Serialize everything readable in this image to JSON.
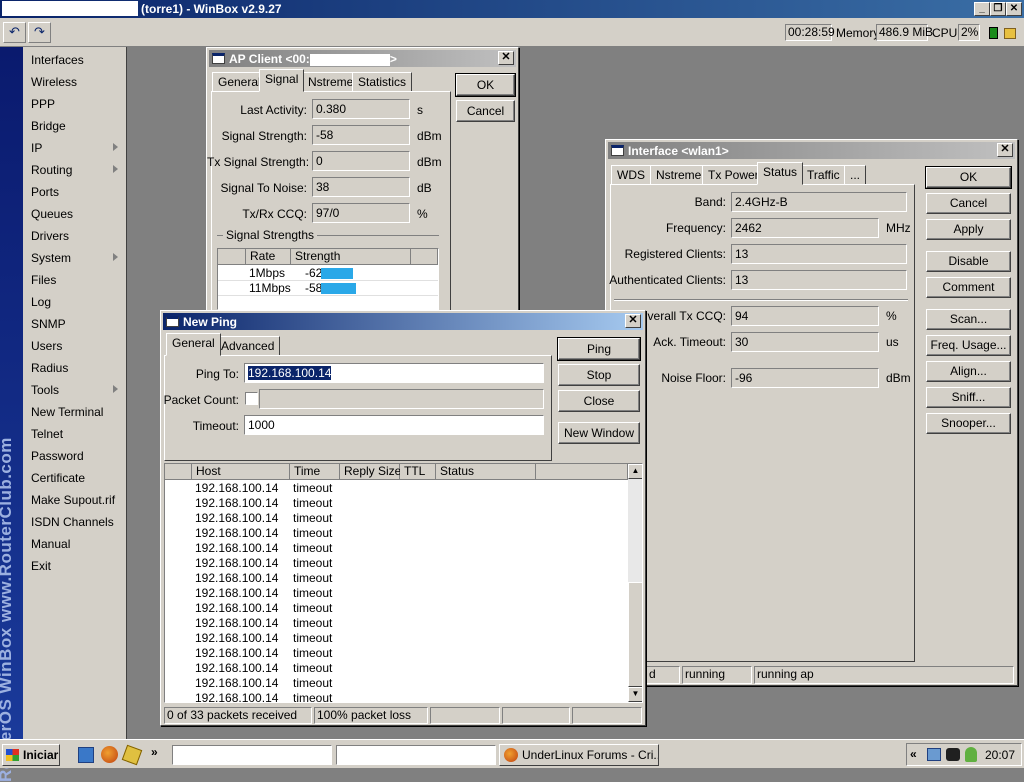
{
  "app": {
    "title": "(torre1) - WinBox v2.9.27"
  },
  "toolbar": {
    "undo_icon": "undo-icon",
    "redo_icon": "redo-icon",
    "uptime": "00:28:59",
    "memory_label": "Memory:",
    "memory_value": "486.9 MiB",
    "cpu_label": "CPU:",
    "cpu_value": "2%"
  },
  "sidebar": {
    "brand": "RouterOS WinBox   www.RouterClub.com",
    "items": [
      {
        "label": "Interfaces"
      },
      {
        "label": "Wireless"
      },
      {
        "label": "PPP"
      },
      {
        "label": "Bridge"
      },
      {
        "label": "IP"
      },
      {
        "label": "Routing"
      },
      {
        "label": "Ports"
      },
      {
        "label": "Queues"
      },
      {
        "label": "Drivers"
      },
      {
        "label": "System"
      },
      {
        "label": "Files"
      },
      {
        "label": "Log"
      },
      {
        "label": "SNMP"
      },
      {
        "label": "Users"
      },
      {
        "label": "Radius"
      },
      {
        "label": "Tools"
      },
      {
        "label": "New Terminal"
      },
      {
        "label": "Telnet"
      },
      {
        "label": "Password"
      },
      {
        "label": "Certificate"
      },
      {
        "label": "Make Supout.rif"
      },
      {
        "label": "ISDN Channels"
      },
      {
        "label": "Manual"
      },
      {
        "label": "Exit"
      }
    ]
  },
  "ap_client": {
    "title_prefix": "AP Client <00:",
    "title_suffix": ">",
    "tabs": [
      "General",
      "Signal",
      "Nstreme",
      "Statistics"
    ],
    "ok": "OK",
    "cancel": "Cancel",
    "fields": {
      "last_activity": {
        "label": "Last Activity:",
        "value": "0.380",
        "unit": "s"
      },
      "signal_strength": {
        "label": "Signal Strength:",
        "value": "-58",
        "unit": "dBm"
      },
      "tx_signal_strength": {
        "label": "Tx Signal Strength:",
        "value": "0",
        "unit": "dBm"
      },
      "signal_to_noise": {
        "label": "Signal To Noise:",
        "value": "38",
        "unit": "dB"
      },
      "txrx_ccq": {
        "label": "Tx/Rx CCQ:",
        "value": "97/0",
        "unit": "%"
      }
    },
    "strengths_group": "Signal Strengths",
    "strengths_headers": [
      "Rate",
      "Strength"
    ],
    "strengths": [
      {
        "rate": "1Mbps",
        "strength": "-62",
        "level": 0.45
      },
      {
        "rate": "11Mbps",
        "strength": "-58",
        "level": 0.5
      }
    ]
  },
  "iface": {
    "title": "Interface <wlan1>",
    "tabs": [
      "WDS",
      "Nstreme",
      "Tx Power",
      "Status",
      "Traffic",
      "..."
    ],
    "buttons": [
      "OK",
      "Cancel",
      "Apply",
      "Disable",
      "Comment",
      "Scan...",
      "Freq. Usage...",
      "Align...",
      "Sniff...",
      "Snooper..."
    ],
    "band": {
      "label": "Band:",
      "value": "2.4GHz-B"
    },
    "frequency": {
      "label": "Frequency:",
      "value": "2462",
      "unit": "MHz"
    },
    "registered": {
      "label": "Registered Clients:",
      "value": "13"
    },
    "authenticated": {
      "label": "Authenticated Clients:",
      "value": "13"
    },
    "overall_ccq": {
      "label": "Overall Tx CCQ:",
      "value": "94",
      "unit": "%"
    },
    "ack_timeout": {
      "label": "Ack. Timeout:",
      "value": "30",
      "unit": "us"
    },
    "noise_floor": {
      "label": "Noise Floor:",
      "value": "-96",
      "unit": "dBm"
    },
    "status": [
      "d",
      "running",
      "running ap"
    ]
  },
  "ping": {
    "title": "New Ping",
    "tabs": [
      "General",
      "Advanced"
    ],
    "ping_to_label": "Ping To:",
    "ping_to_value": "192.168.100.14",
    "packet_count_label": "Packet Count:",
    "timeout_label": "Timeout:",
    "timeout_value": "1000",
    "buttons": {
      "ping": "Ping",
      "stop": "Stop",
      "close": "Close",
      "new_window": "New Window"
    },
    "columns": [
      "Host",
      "Time",
      "Reply Size",
      "TTL",
      "Status"
    ],
    "rows": [
      {
        "host": "192.168.100.14",
        "time": "timeout"
      },
      {
        "host": "192.168.100.14",
        "time": "timeout"
      },
      {
        "host": "192.168.100.14",
        "time": "timeout"
      },
      {
        "host": "192.168.100.14",
        "time": "timeout"
      },
      {
        "host": "192.168.100.14",
        "time": "timeout"
      },
      {
        "host": "192.168.100.14",
        "time": "timeout"
      },
      {
        "host": "192.168.100.14",
        "time": "timeout"
      },
      {
        "host": "192.168.100.14",
        "time": "timeout"
      },
      {
        "host": "192.168.100.14",
        "time": "timeout"
      },
      {
        "host": "192.168.100.14",
        "time": "timeout"
      },
      {
        "host": "192.168.100.14",
        "time": "timeout"
      },
      {
        "host": "192.168.100.14",
        "time": "timeout"
      },
      {
        "host": "192.168.100.14",
        "time": "timeout"
      },
      {
        "host": "192.168.100.14",
        "time": "timeout"
      },
      {
        "host": "192.168.100.14",
        "time": "timeout"
      }
    ],
    "status_received": "0 of 33 packets received",
    "status_loss": "100% packet loss"
  },
  "taskbar": {
    "start": "Iniciar",
    "task": "UnderLinux Forums - Cri...",
    "chevron": "»",
    "tray_chevron": "«",
    "clock": "20:07",
    "accent": "#0a246a"
  }
}
